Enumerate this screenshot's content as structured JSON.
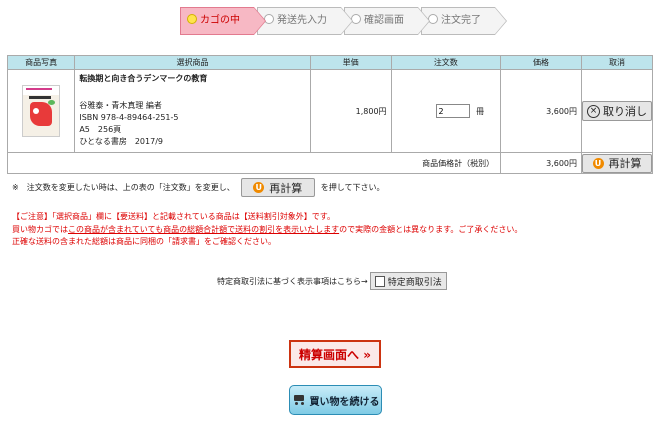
{
  "steps": [
    {
      "label": "カゴの中"
    },
    {
      "label": "発送先入力"
    },
    {
      "label": "確認画面"
    },
    {
      "label": "注文完了"
    }
  ],
  "table": {
    "headers": [
      "商品写真",
      "選択商品",
      "単価",
      "注文数",
      "価格",
      "取消"
    ],
    "item": {
      "title": "転換期と向き合うデンマークの教育",
      "author": "谷雅泰・青木真理 編者",
      "isbn": "ISBN 978-4-89464-251-5",
      "format": "A5　256頁",
      "publisher": "ひとなる書房　2017/9",
      "unit_price": "1,800円",
      "quantity": "2",
      "qty_unit": "冊",
      "price": "3,600円",
      "delete_label": "取り消し"
    },
    "subtotal_label": "商品価格計（税別）",
    "subtotal": "3,600円",
    "recalc_label": "再計算"
  },
  "note": {
    "before": "※　注文数を変更したい時は、上の表の「注文数」を変更し、",
    "button": "再計算",
    "after": "を押して下さい。"
  },
  "warnings": {
    "line1": "【ご注意】「選択商品」欄に【要送料】と記載されている商品は【送料割引対象外】です。",
    "line2_a": "買い物カゴでは",
    "line2_u": "この商品が含まれていても商品の総額合計額で送料の割引を表示いたします",
    "line2_b": "ので実際の金額とは異なります。ご了承ください。",
    "line3": "正確な送料の含まれた総額は商品に同梱の「請求書」をご確認ください。"
  },
  "law": {
    "text": "特定商取引法に基づく表示事項はこちら→",
    "button": "特定商取引法"
  },
  "checkout_label": "精算画面へ »",
  "continue_label": "買い物を続ける",
  "colors": {
    "header_bg": "#bde4ec",
    "active_step": "#f7b8c4",
    "warning": "#dd0000"
  }
}
